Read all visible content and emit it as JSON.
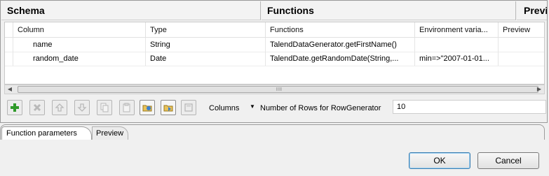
{
  "sections": {
    "schema_title": "Schema",
    "functions_title": "Functions",
    "preview_title": "Previe"
  },
  "table": {
    "columns": [
      "Column",
      "Type",
      "Functions",
      "Environment varia...",
      "Preview"
    ],
    "rows": [
      {
        "column": "name",
        "type": "String",
        "function": "TalendDataGenerator.getFirstName()",
        "env": "",
        "preview": ""
      },
      {
        "column": "random_date",
        "type": "Date",
        "function": "TalendDate.getRandomDate(String,...",
        "env": "min=>\"2007-01-01...",
        "preview": ""
      }
    ]
  },
  "scrollbar": {
    "grip": "III"
  },
  "toolbar": {
    "buttons": [
      {
        "name": "add-icon",
        "enabled": true
      },
      {
        "name": "remove-icon",
        "enabled": false
      },
      {
        "name": "move-up-icon",
        "enabled": false
      },
      {
        "name": "move-down-icon",
        "enabled": false
      },
      {
        "name": "copy-icon",
        "enabled": false
      },
      {
        "name": "paste-icon",
        "enabled": false
      },
      {
        "name": "import-icon",
        "enabled": true
      },
      {
        "name": "export-icon",
        "enabled": true
      },
      {
        "name": "save-icon",
        "enabled": false
      }
    ],
    "columns_label": "Columns",
    "rows_label": "Number of Rows for RowGenerator",
    "rows_value": "10"
  },
  "tabs": {
    "function_parameters": "Function parameters",
    "preview": "Preview"
  },
  "dialog": {
    "ok": "OK",
    "cancel": "Cancel"
  },
  "colors": {
    "add_green": "#2f9a2a",
    "ok_border": "#3c7fb1"
  }
}
